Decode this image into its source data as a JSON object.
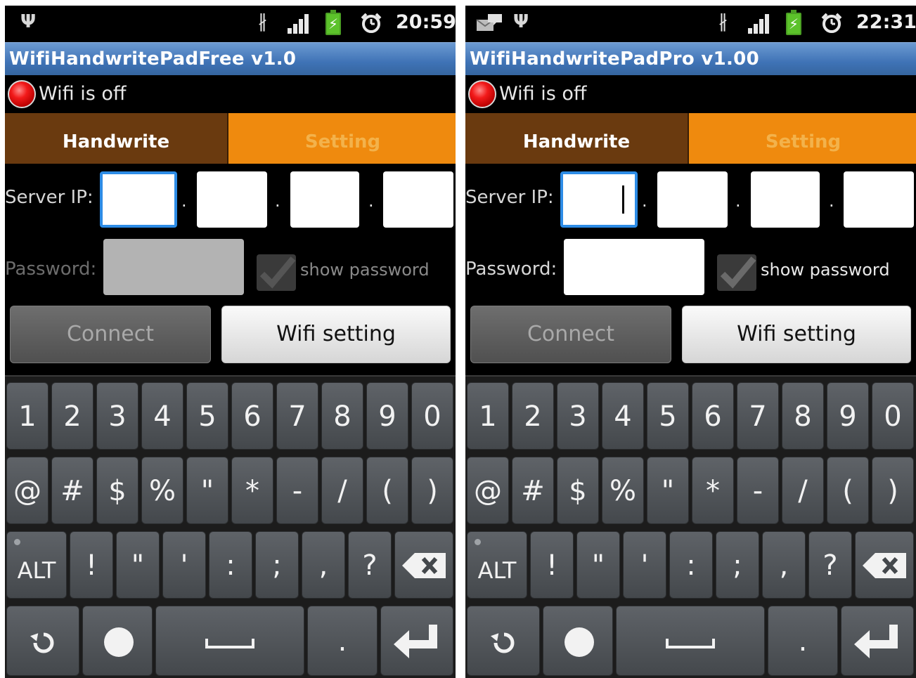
{
  "screens": [
    {
      "status": {
        "time": "20:59"
      },
      "title": "WifiHandwritePadFree v1.0",
      "wifi_status": "Wifi is off",
      "tabs": [
        "Handwrite",
        "Setting"
      ],
      "server_ip_label": "Server IP:",
      "ip_separator": ".",
      "password_label": "Password:",
      "show_password_label": "show password",
      "connect_label": "Connect",
      "wifi_setting_label": "Wifi setting",
      "password_enabled": false
    },
    {
      "status": {
        "time": "22:31"
      },
      "title": "WifiHandwritePadPro v1.00",
      "wifi_status": "Wifi is off",
      "tabs": [
        "Handwrite",
        "Setting"
      ],
      "server_ip_label": "Server IP:",
      "ip_separator": ".",
      "password_label": "Password:",
      "show_password_label": "show password",
      "connect_label": "Connect",
      "wifi_setting_label": "Wifi setting",
      "password_enabled": true
    }
  ],
  "keyboard": {
    "row1": [
      "1",
      "2",
      "3",
      "4",
      "5",
      "6",
      "7",
      "8",
      "9",
      "0"
    ],
    "row2": [
      "@",
      "#",
      "$",
      "%",
      "\"",
      "*",
      "-",
      "/",
      "(",
      ")"
    ],
    "row3": [
      "ALT",
      "!",
      "\"",
      "'",
      ":",
      ";",
      ",",
      "?"
    ],
    "row4_period": "."
  },
  "colors": {
    "title_bar": "#3f73b6",
    "tab_active": "#6a3a0f",
    "tab_inactive": "#ef8a0e",
    "focus_border": "#2d8ce6",
    "wifi_off_led": "#f21a1a"
  },
  "icons": [
    "usb-icon",
    "bluetooth-icon",
    "signal-icon",
    "battery-charging-icon",
    "alarm-icon",
    "notification-message-icon",
    "rotate-icon",
    "backspace-icon",
    "enter-icon",
    "space-icon"
  ]
}
